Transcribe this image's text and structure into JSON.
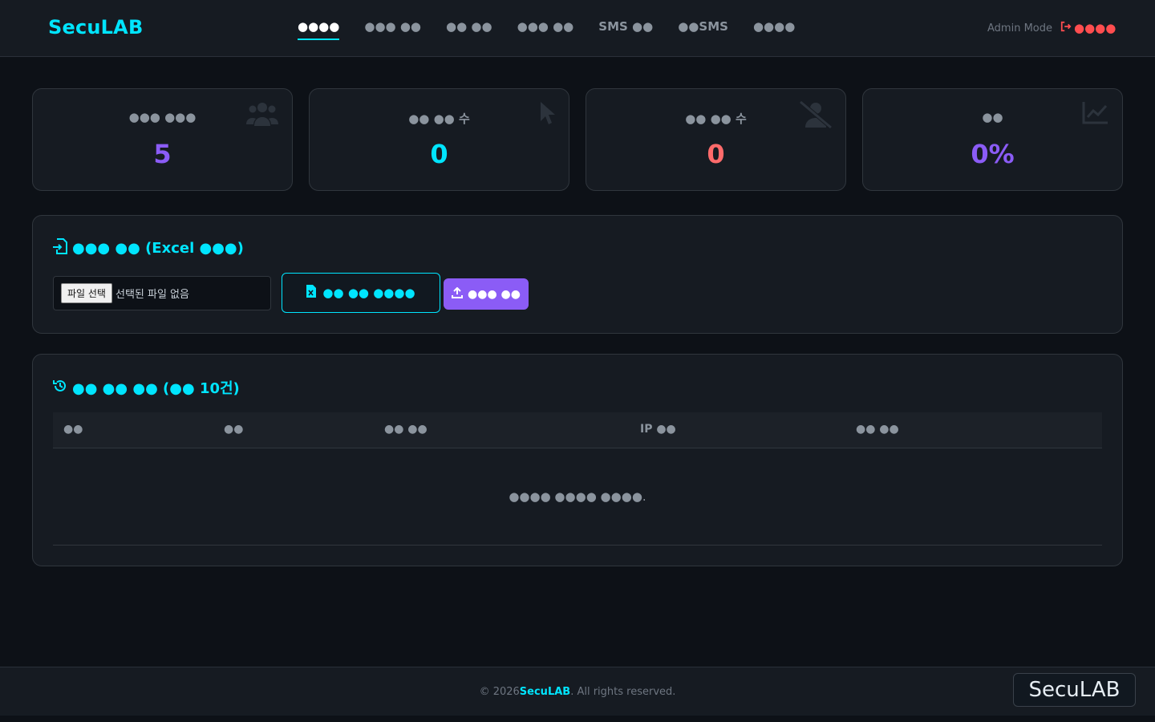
{
  "brand": "SecuLAB",
  "nav": [
    "●●●●",
    "●●● ●●",
    "●● ●●",
    "●●● ●●",
    "SMS ●●",
    "●●SMS",
    "●●●●"
  ],
  "admin_mode": "Admin Mode",
  "logout_label": "●●●●",
  "stats": [
    {
      "label": "●●● ●●●",
      "value": "5",
      "color": "#8b5cf6",
      "icon": "users-icon"
    },
    {
      "label": "●● ●● 수",
      "value": "0",
      "color": "#00e5ff",
      "icon": "pointer-icon"
    },
    {
      "label": "●● ●● 수",
      "value": "0",
      "color": "#ff6b6b",
      "icon": "user-slash-icon"
    },
    {
      "label": "●●",
      "value": "0%",
      "color": "#8b5cf6",
      "icon": "chart-line-icon"
    }
  ],
  "upload_panel": {
    "title": "●●● ●● (Excel ●●●)",
    "file_button": "파일 선택",
    "file_status": "선택된 파일 없음",
    "template_button": "●● ●● ●●●●",
    "upload_button": "●●● ●●"
  },
  "history_panel": {
    "title": "●● ●● ●● (●● 10건)",
    "columns": [
      "●●",
      "●●",
      "●● ●●",
      "IP ●●",
      "●● ●●"
    ],
    "empty_message": "●●●● ●●●● ●●●●."
  },
  "footer": {
    "prefix": "© 2026 ",
    "brand": "SecuLAB",
    "suffix": ". All rights reserved."
  },
  "footer_badge": "SecuLAB"
}
